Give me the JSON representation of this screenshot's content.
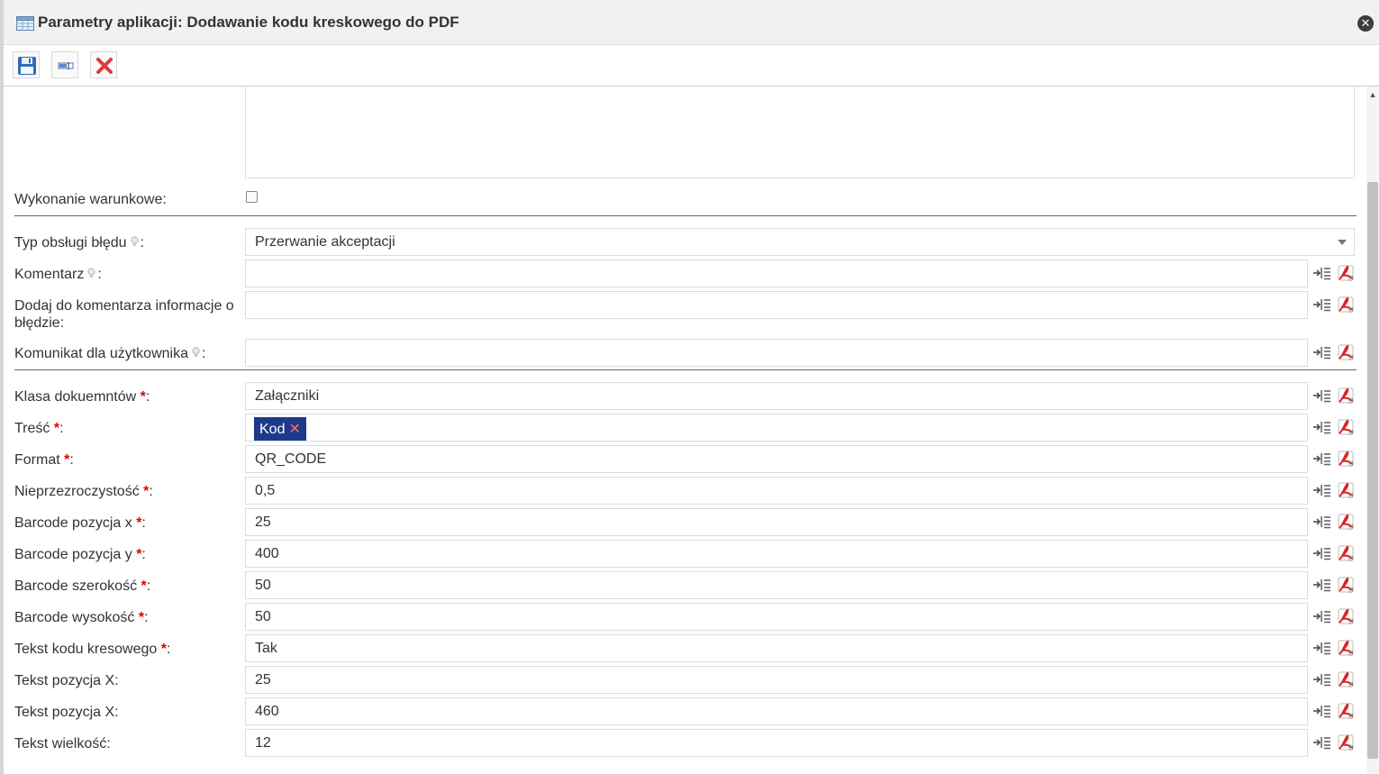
{
  "window": {
    "title": "Parametry aplikacji: Dodawanie kodu kreskowego do PDF"
  },
  "toolbar": {
    "save": "save-icon",
    "rename": "field-icon",
    "cancel": "close-x-icon"
  },
  "conditional": {
    "label": "Wykonanie warunkowe:",
    "checked": false
  },
  "error_handling": {
    "type_label": "Typ obsługi błędu",
    "type_value": "Przerwanie akceptacji",
    "comment_label": "Komentarz",
    "comment_value": "",
    "add_info_label": "Dodaj do komentarza informacje o błędzie:",
    "add_info_value": "",
    "user_message_label": "Komunikat dla użytkownika",
    "user_message_value": ""
  },
  "params": [
    {
      "label": "Klasa dokuemntów",
      "required": true,
      "value": "Załączniki"
    },
    {
      "label": "Treść",
      "required": true,
      "tag": "Kod"
    },
    {
      "label": "Format",
      "required": true,
      "value": "QR_CODE"
    },
    {
      "label": "Nieprzezroczystość",
      "required": true,
      "value": "0,5"
    },
    {
      "label": "Barcode pozycja x",
      "required": true,
      "value": "25"
    },
    {
      "label": "Barcode pozycja y",
      "required": true,
      "value": "400"
    },
    {
      "label": "Barcode szerokość",
      "required": true,
      "value": "50"
    },
    {
      "label": "Barcode wysokość",
      "required": true,
      "value": "50"
    },
    {
      "label": "Tekst kodu kresowego",
      "required": true,
      "value": "Tak"
    },
    {
      "label": "Tekst pozycja X:",
      "required": false,
      "value": "25"
    },
    {
      "label": "Tekst pozycja X:",
      "required": false,
      "value": "460"
    },
    {
      "label": "Tekst wielkość:",
      "required": false,
      "value": "12"
    }
  ],
  "markers": {
    "required": "*",
    "colon": ":"
  },
  "colors": {
    "accent": "#1e3a8a",
    "required": "#e00000",
    "separator": "#4d6f8e"
  }
}
